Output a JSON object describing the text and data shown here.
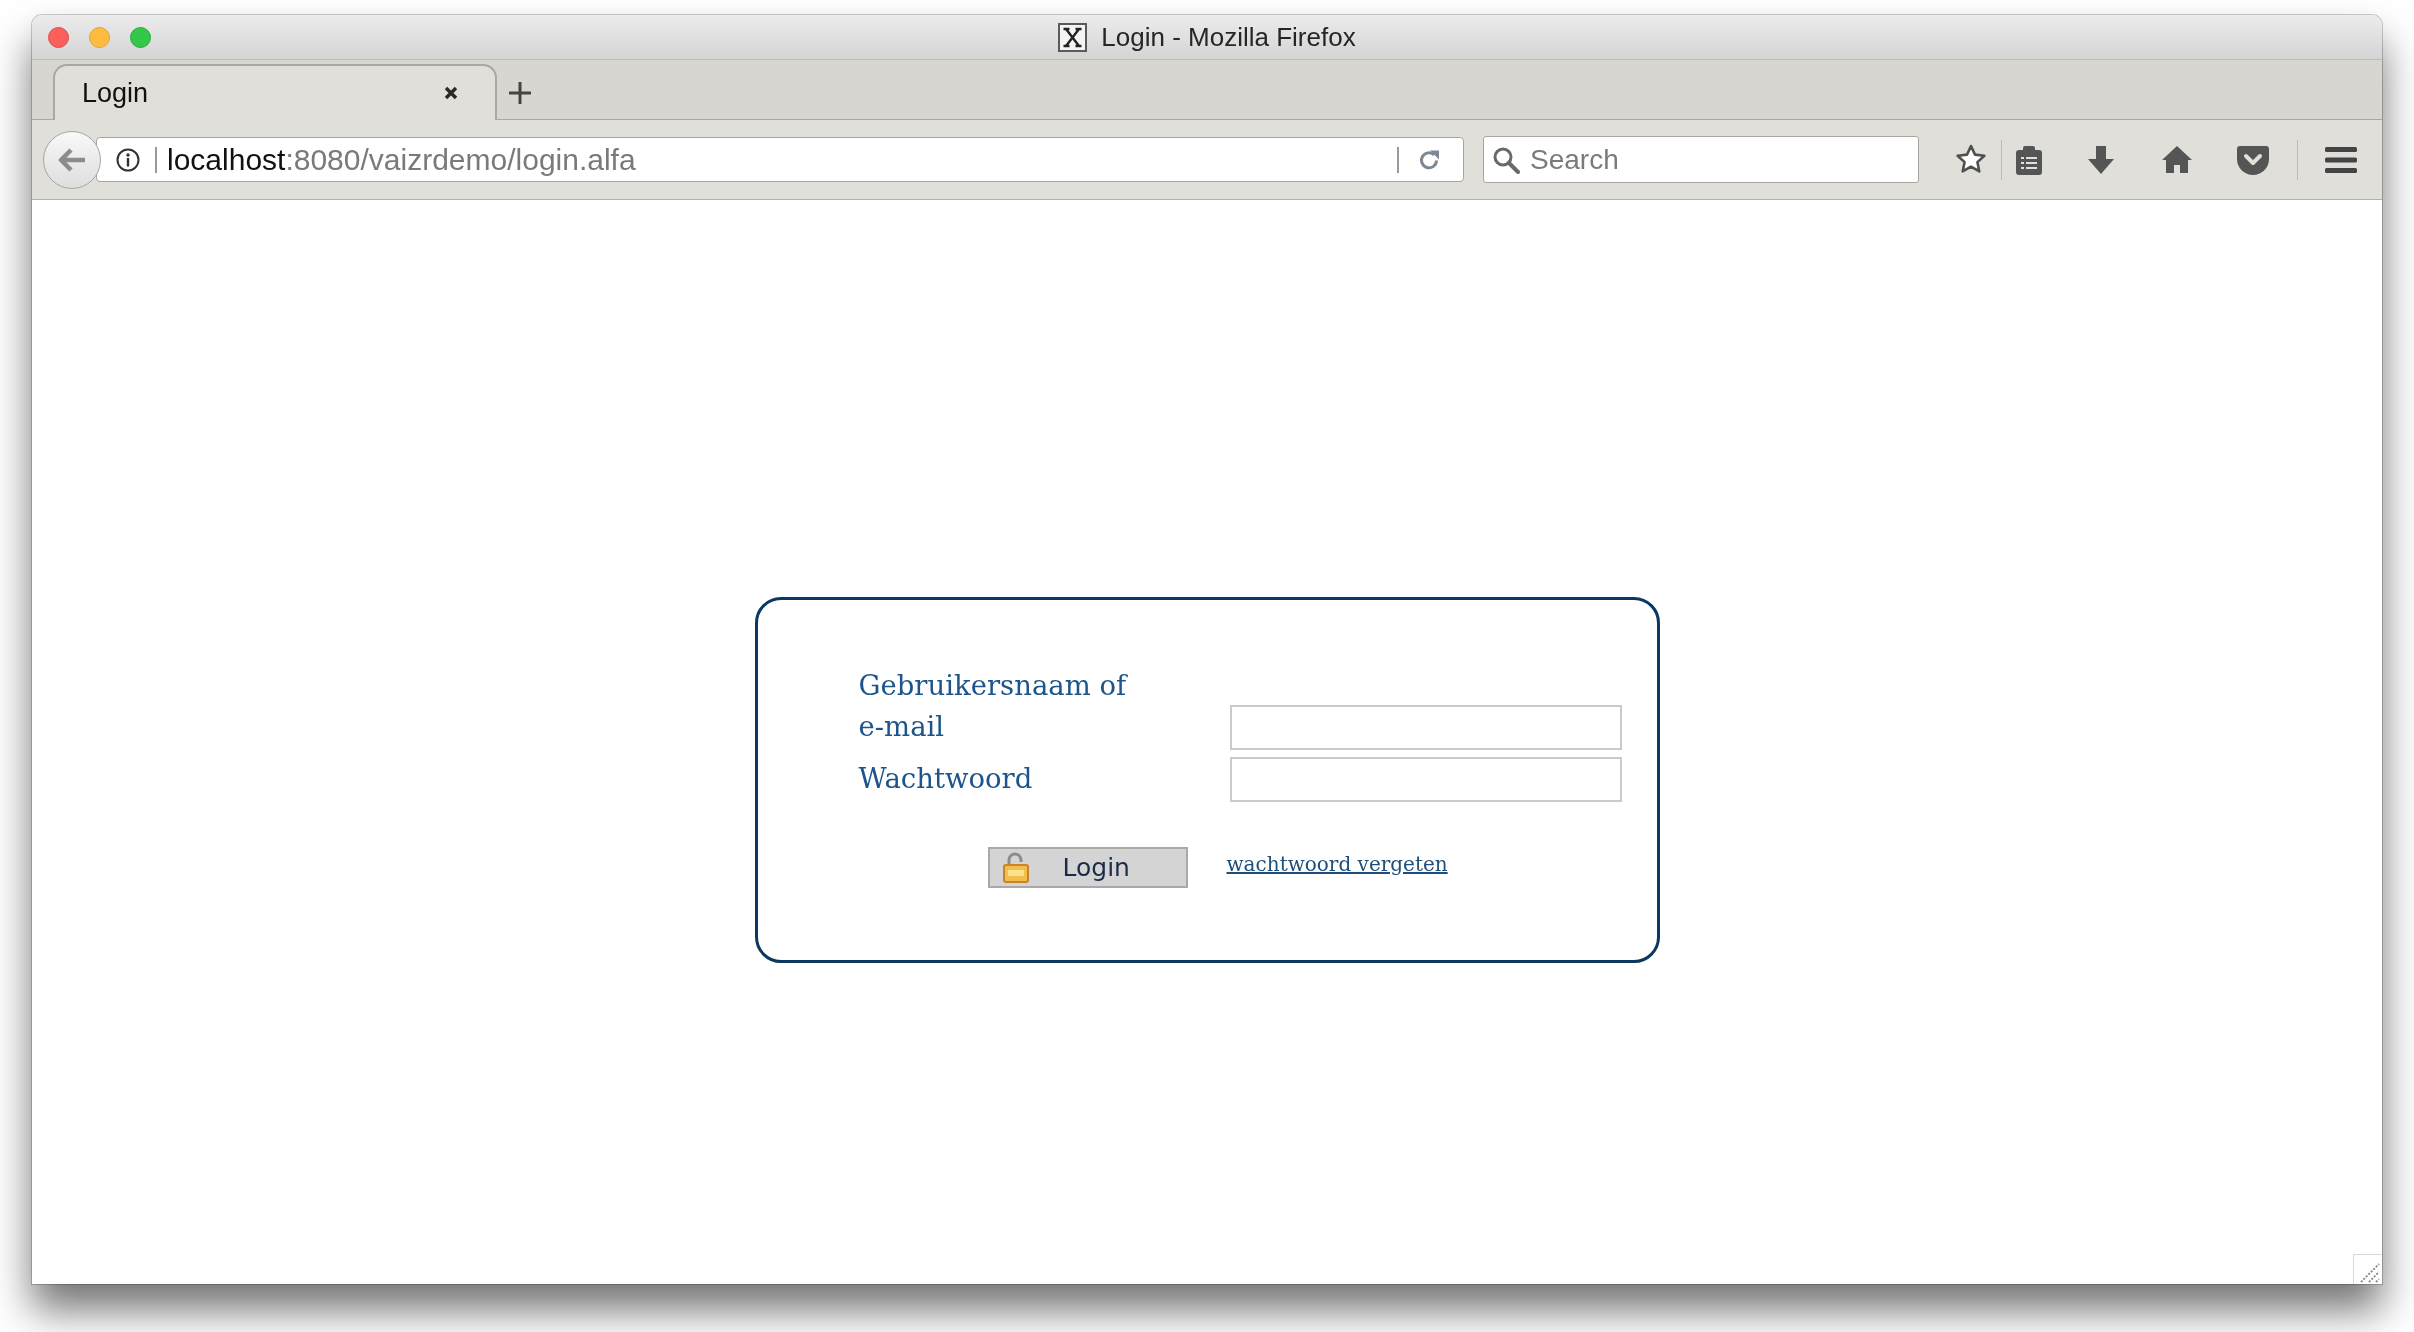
{
  "window": {
    "title": "Login - Mozilla Firefox"
  },
  "tabs": [
    {
      "label": "Login",
      "selected": true
    }
  ],
  "address_bar": {
    "host": "localhost",
    "path": ":8080/vaizrdemo/login.alfa"
  },
  "search": {
    "placeholder": "Search"
  },
  "login_form": {
    "fields": [
      {
        "label": "Gebruikersnaam of e-mail"
      },
      {
        "label": "Wachtwoord"
      }
    ],
    "submit_button": "Login",
    "forgot_password_link": "wachtwoord vergeten"
  }
}
